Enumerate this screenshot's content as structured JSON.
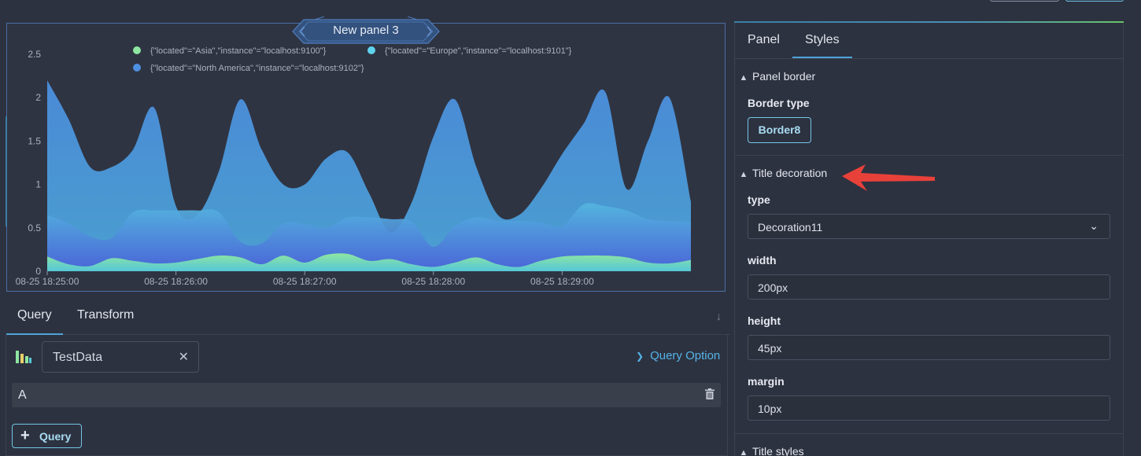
{
  "panel": {
    "title": "New panel 3",
    "legend": [
      {
        "label": "{\"located\"=\"Asia\",\"instance\"=\"localhost:9100\"}",
        "color": "#8ee6a0"
      },
      {
        "label": "{\"located\"=\"Europe\",\"instance\"=\"localhost:9101\"}",
        "color": "#5fd3ee"
      },
      {
        "label": "{\"located\"=\"North America\",\"instance\"=\"localhost:9102\"}",
        "color": "#4d8fe0"
      }
    ]
  },
  "chart_data": {
    "type": "area",
    "x": [
      "08-25 18:25:00",
      "08-25 18:25:10",
      "08-25 18:25:20",
      "08-25 18:25:30",
      "08-25 18:25:40",
      "08-25 18:25:50",
      "08-25 18:26:00",
      "08-25 18:26:10",
      "08-25 18:26:20",
      "08-25 18:26:30",
      "08-25 18:26:40",
      "08-25 18:26:50",
      "08-25 18:27:00",
      "08-25 18:27:10",
      "08-25 18:27:20",
      "08-25 18:27:30",
      "08-25 18:27:40",
      "08-25 18:27:50",
      "08-25 18:28:00",
      "08-25 18:28:10",
      "08-25 18:28:20",
      "08-25 18:28:30",
      "08-25 18:28:40",
      "08-25 18:28:50",
      "08-25 18:29:00",
      "08-25 18:29:10",
      "08-25 18:29:20",
      "08-25 18:29:30",
      "08-25 18:29:40",
      "08-25 18:29:50",
      "08-25 18:30:00"
    ],
    "x_ticks": [
      "08-25 18:25:00",
      "08-25 18:26:00",
      "08-25 18:27:00",
      "08-25 18:28:00",
      "08-25 18:29:00"
    ],
    "y_ticks": [
      "0",
      "0.5",
      "1",
      "1.5",
      "2",
      "2.5"
    ],
    "ylim": [
      0,
      2.5
    ],
    "series": [
      {
        "name": "{\"located\"=\"Asia\",\"instance\"=\"localhost:9100\"}",
        "color": "#8ee6a0",
        "values": [
          0.17,
          0.08,
          0.06,
          0.15,
          0.12,
          0.09,
          0.1,
          0.14,
          0.18,
          0.16,
          0.08,
          0.18,
          0.1,
          0.19,
          0.2,
          0.12,
          0.14,
          0.08,
          0.05,
          0.1,
          0.16,
          0.08,
          0.05,
          0.12,
          0.17,
          0.18,
          0.18,
          0.16,
          0.1,
          0.09,
          0.13
        ]
      },
      {
        "name": "{\"located\"=\"Europe\",\"instance\"=\"localhost:9101\"}",
        "color": "#5fd3ee",
        "values": [
          0.65,
          0.55,
          0.4,
          0.38,
          0.68,
          0.7,
          0.7,
          0.7,
          0.68,
          0.34,
          0.32,
          0.55,
          0.54,
          0.5,
          0.62,
          0.62,
          0.6,
          0.57,
          0.28,
          0.52,
          0.62,
          0.58,
          0.58,
          0.56,
          0.52,
          0.77,
          0.75,
          0.7,
          0.6,
          0.58,
          0.57
        ]
      },
      {
        "name": "{\"located\"=\"North America\",\"instance\"=\"localhost:9102\"}",
        "color": "#4d8fe0",
        "values": [
          2.2,
          1.75,
          1.2,
          1.2,
          1.4,
          1.88,
          0.75,
          0.65,
          1.15,
          1.98,
          1.4,
          1.0,
          1.0,
          1.3,
          1.37,
          0.9,
          0.45,
          0.8,
          1.55,
          1.98,
          1.2,
          0.65,
          0.65,
          0.95,
          1.35,
          1.7,
          2.07,
          0.95,
          1.5,
          2.0,
          0.8
        ]
      }
    ]
  },
  "query": {
    "tabs": [
      "Query",
      "Transform"
    ],
    "datasource": "TestData",
    "query_option": "Query Option",
    "row_label": "A",
    "add_query": "Query"
  },
  "options": {
    "tabs": [
      "Panel",
      "Styles"
    ],
    "panel_border_title": "Panel border",
    "border_type_label": "Border type",
    "border_type_value": "Border8",
    "title_decoration_title": "Title decoration",
    "type_label": "type",
    "type_value": "Decoration11",
    "width_label": "width",
    "width_value": "200px",
    "height_label": "height",
    "height_value": "45px",
    "margin_label": "margin",
    "margin_value": "10px",
    "title_styles_title": "Title styles"
  },
  "colors": {
    "accent": "#4fa3d9",
    "annotation_arrow": "#e8413a"
  }
}
